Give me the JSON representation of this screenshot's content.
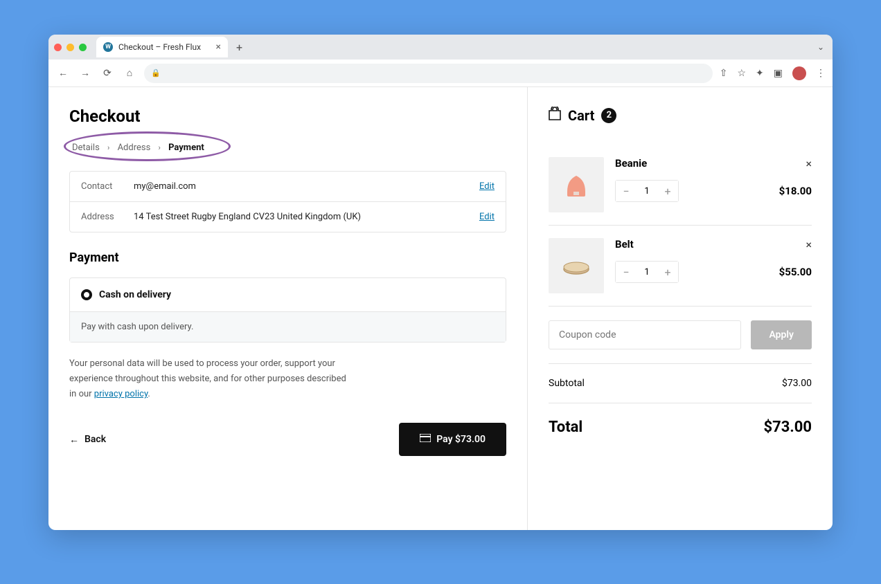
{
  "browser": {
    "tabTitle": "Checkout – Fresh Flux"
  },
  "checkout": {
    "title": "Checkout",
    "breadcrumb": {
      "step1": "Details",
      "step2": "Address",
      "step3": "Payment"
    },
    "info": {
      "contactLabel": "Contact",
      "contactValue": "my@email.com",
      "addressLabel": "Address",
      "addressValue": "14 Test Street Rugby England CV23 United Kingdom (UK)",
      "editLabel": "Edit"
    },
    "paymentTitle": "Payment",
    "method": {
      "name": "Cash on delivery",
      "desc": "Pay with cash upon delivery."
    },
    "privacyText": "Your personal data will be used to process your order, support your experience throughout this website, and for other purposes described in our ",
    "privacyLink": "privacy policy",
    "backLabel": "Back",
    "payLabel": "Pay $73.00"
  },
  "cart": {
    "title": "Cart",
    "count": "2",
    "items": [
      {
        "name": "Beanie",
        "qty": "1",
        "price": "$18.00"
      },
      {
        "name": "Belt",
        "qty": "1",
        "price": "$55.00"
      }
    ],
    "couponPlaceholder": "Coupon code",
    "applyLabel": "Apply",
    "subtotalLabel": "Subtotal",
    "subtotalValue": "$73.00",
    "totalLabel": "Total",
    "totalValue": "$73.00"
  }
}
